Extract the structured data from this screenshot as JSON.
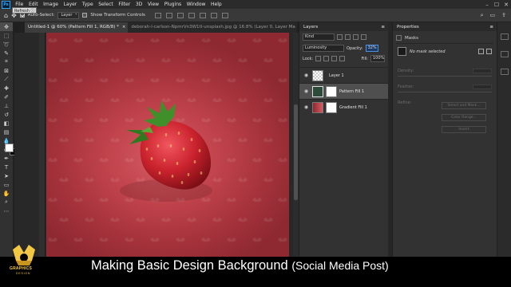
{
  "menubar": {
    "logo": "Ps",
    "items": [
      "File",
      "Edit",
      "Image",
      "Layer",
      "Type",
      "Select",
      "Filter",
      "3D",
      "View",
      "Plugins",
      "Window",
      "Help"
    ],
    "window_controls": [
      "minimize-icon",
      "maximize-icon",
      "close-icon"
    ]
  },
  "tooltip": {
    "text": "Refresh ⓘ"
  },
  "options": {
    "auto_select_label": "Auto-Select:",
    "auto_select_value": "Layer",
    "transform_label": "Show Transform Controls"
  },
  "tabs": [
    {
      "label": "Untitled-1 @ 60% (Pattern Fill 1, RGB/8) *",
      "close": "×"
    },
    {
      "label": "deborah-l-carlson-NpmrVn3W1tI-unsplash.jpg @ 16.8% (Layer 0, Layer Ma",
      "close": "×"
    }
  ],
  "layers_panel": {
    "title": "Layers",
    "filter_kind": "Kind",
    "blend_mode": "Luminosity",
    "opacity_label": "Opacity:",
    "opacity_value": "32%",
    "lock_label": "Lock:",
    "fill_label": "Fill:",
    "fill_value": "100%",
    "layers": [
      {
        "name": "Layer 1"
      },
      {
        "name": "Pattern Fill 1"
      },
      {
        "name": "Gradient Fill 1"
      }
    ]
  },
  "properties_panel": {
    "title": "Properties",
    "section": "Masks",
    "note": "No mask selected",
    "density_label": "Density:",
    "feather_label": "Feather:",
    "refine_label": "Refine:",
    "select_mask_button": "Select and Mask...",
    "color_range_button": "Color Range...",
    "invert_button": "Invert"
  },
  "caption": {
    "main": "Making Basic Design Background",
    "sub": "(Social Media Post)"
  },
  "logo": {
    "text": "GRAPHICS",
    "subtext": "DESIGN"
  },
  "colors": {
    "accent": "#31a8ff",
    "canvas_center": "#d45b63",
    "canvas_edge": "#8e2931",
    "logo_gold": "#f2c744"
  }
}
